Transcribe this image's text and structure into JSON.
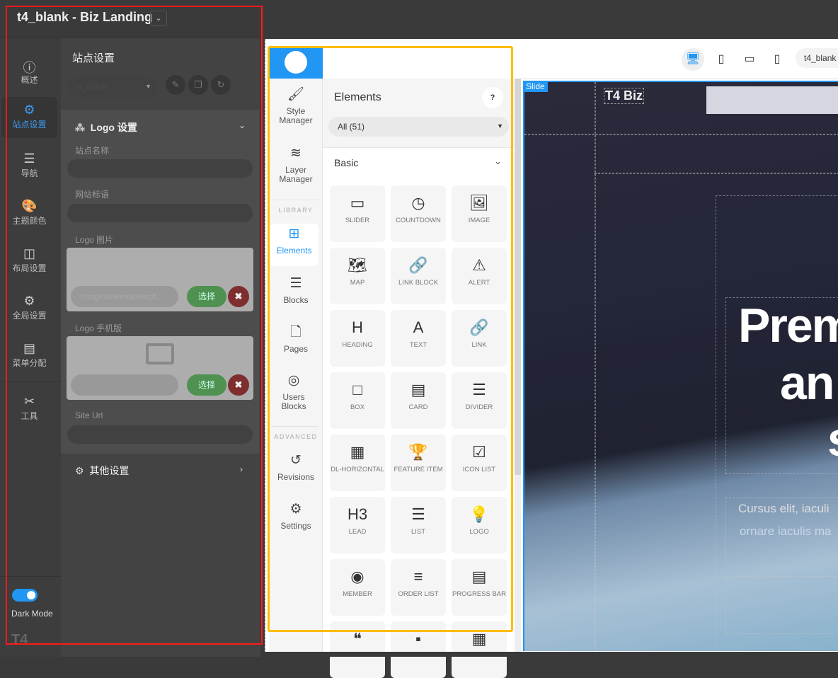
{
  "header": {
    "title": "t4_blank - Biz Landing",
    "dropdown_icon": "chevron-down"
  },
  "rail": {
    "items": [
      {
        "label": "概述",
        "icon": "info-icon"
      },
      {
        "label": "站点设置",
        "icon": "gear-icon",
        "active": true
      },
      {
        "label": "导航",
        "icon": "menu-icon"
      },
      {
        "label": "主题颜色",
        "icon": "palette-icon"
      },
      {
        "label": "布局设置",
        "icon": "layout-icon"
      },
      {
        "label": "全局设置",
        "icon": "gears-icon"
      },
      {
        "label": "菜单分配",
        "icon": "list-icon"
      },
      {
        "label": "工具",
        "icon": "tools-icon"
      }
    ],
    "dark_mode_label": "Dark Mode",
    "dark_mode_on": true,
    "footer_logo": "T4"
  },
  "panel": {
    "title": "站点设置",
    "site_select": "t4_blank",
    "logo_section": {
      "title": "Logo 设置",
      "site_name_label": "站点名称",
      "site_name_value": "",
      "slogan_label": "网站标语",
      "slogan_value": "",
      "logo_image_label": "Logo 图片",
      "logo_image_path": "images/demo/misc/t...",
      "logo_mobile_label": "Logo 手机版",
      "logo_mobile_path": "",
      "select_label": "选择",
      "site_url_label": "Site Url",
      "site_url_value": ""
    },
    "other_section": {
      "title": "其他设置"
    }
  },
  "builder": {
    "nav": {
      "style_manager": "Style Manager",
      "layer_manager": "Layer Manager",
      "library": "LIBRARY",
      "elements": "Elements",
      "blocks": "Blocks",
      "pages": "Pages",
      "users_blocks": "Users Blocks",
      "advanced": "ADVANCED",
      "revisions": "Revisions",
      "settings": "Settings"
    },
    "elements_panel": {
      "title": "Elements",
      "help": "?",
      "filter": "All (51)",
      "category": "Basic",
      "tiles": [
        {
          "label": "SLIDER",
          "icon": "▭"
        },
        {
          "label": "COUNTDOWN",
          "icon": "◷"
        },
        {
          "label": "IMAGE",
          "icon": "🖼"
        },
        {
          "label": "MAP",
          "icon": "🗺"
        },
        {
          "label": "LINK BLOCK",
          "icon": "🔗"
        },
        {
          "label": "ALERT",
          "icon": "⚠"
        },
        {
          "label": "HEADING",
          "icon": "H"
        },
        {
          "label": "TEXT",
          "icon": "A"
        },
        {
          "label": "LINK",
          "icon": "🔗"
        },
        {
          "label": "BOX",
          "icon": "□"
        },
        {
          "label": "CARD",
          "icon": "▤"
        },
        {
          "label": "DIVIDER",
          "icon": "☰"
        },
        {
          "label": "DL-HORIZONTAL",
          "icon": "▦"
        },
        {
          "label": "FEATURE ITEM",
          "icon": "🏆"
        },
        {
          "label": "ICON LIST",
          "icon": "☑"
        },
        {
          "label": "LEAD",
          "icon": "H3"
        },
        {
          "label": "LIST",
          "icon": "☰"
        },
        {
          "label": "LOGO",
          "icon": "💡"
        },
        {
          "label": "MEMBER",
          "icon": "◉"
        },
        {
          "label": "ORDER LIST",
          "icon": "≡"
        },
        {
          "label": "PROGRESS BAR",
          "icon": "▤"
        },
        {
          "label": "",
          "icon": "❝"
        },
        {
          "label": "",
          "icon": "▪"
        },
        {
          "label": "",
          "icon": "▦"
        }
      ]
    },
    "toolbar": {
      "template": "t4_blank"
    },
    "preview": {
      "slide_badge": "Slide",
      "logo": "T4 Biz",
      "heading": [
        "Prem",
        "an",
        "s"
      ],
      "subtitle": [
        "Cursus elit, iaculi",
        "ornare iaculis ma"
      ]
    }
  }
}
